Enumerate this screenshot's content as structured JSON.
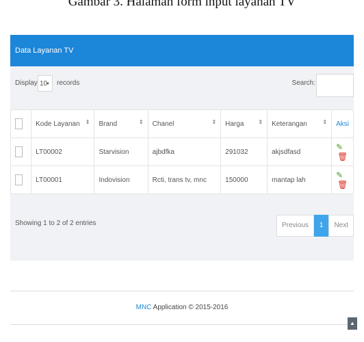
{
  "caption": "Gambar 3. Halaman form input layanan TV",
  "panel": {
    "title": "Data Layanan TV",
    "display_label": "Display",
    "page_size": "10",
    "records_label": "records",
    "search_label": "Search:",
    "search_value": ""
  },
  "table": {
    "headers": [
      "Kode Layanan",
      "Brand",
      "Chanel",
      "Harga",
      "Keterangan",
      "Aksi"
    ],
    "rows": [
      [
        "LT00002",
        "Starvision",
        "ajbdfka",
        "291032",
        "akjsdfasd"
      ],
      [
        "LT00001",
        "Indovision",
        "Rcti, trans tv, mnc",
        "150000",
        "mantap lah"
      ]
    ],
    "icons": {
      "edit": "pencil-icon",
      "delete": "trash-icon"
    }
  },
  "info": "Showing 1 to 2 of 2 entries",
  "pager": {
    "previous": "Previous",
    "current": "1",
    "next": "Next"
  },
  "footer": {
    "brand": "MNC",
    "text": " Application © 2015-2016"
  },
  "scroll_top_icon": "chevron-up-icon",
  "colors": {
    "primary": "#1c86d8",
    "edit": "#4a9a22",
    "delete": "#d9342b"
  }
}
